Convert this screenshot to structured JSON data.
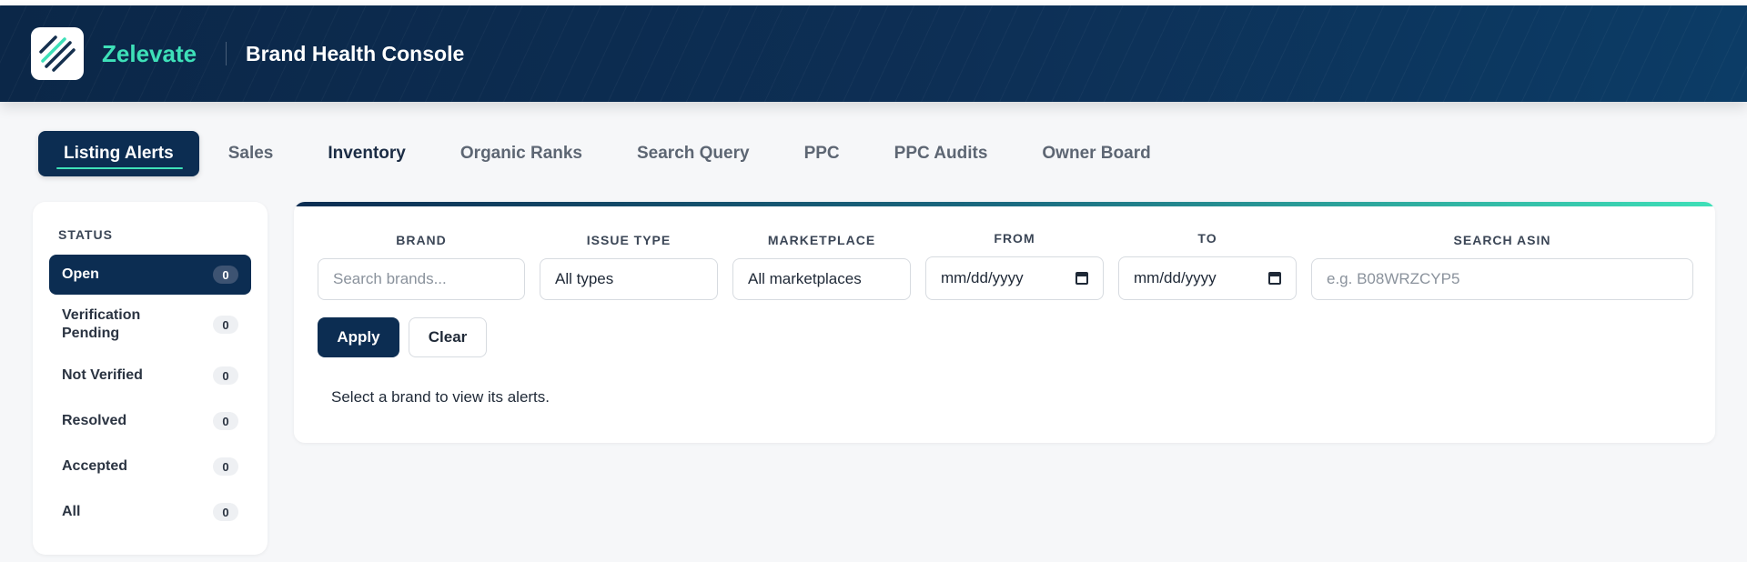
{
  "header": {
    "brand": "Zelevate",
    "title": "Brand Health Console"
  },
  "tabs": [
    {
      "label": "Listing Alerts",
      "active": true
    },
    {
      "label": "Sales"
    },
    {
      "label": "Inventory"
    },
    {
      "label": "Organic Ranks"
    },
    {
      "label": "Search Query"
    },
    {
      "label": "PPC"
    },
    {
      "label": "PPC Audits"
    },
    {
      "label": "Owner Board"
    }
  ],
  "sidebar": {
    "heading": "STATUS",
    "items": [
      {
        "label": "Open",
        "count": "0"
      },
      {
        "label": "Verification Pending",
        "count": "0"
      },
      {
        "label": "Not Verified",
        "count": "0"
      },
      {
        "label": "Resolved",
        "count": "0"
      },
      {
        "label": "Accepted",
        "count": "0"
      },
      {
        "label": "All",
        "count": "0"
      }
    ]
  },
  "filters": {
    "brand_label": "BRAND",
    "brand_placeholder": "Search brands...",
    "issue_label": "ISSUE TYPE",
    "issue_value": "All types",
    "marketplace_label": "MARKETPLACE",
    "marketplace_value": "All marketplaces",
    "from_label": "FROM",
    "from_value": "mm/dd/yyyy",
    "to_label": "TO",
    "to_value": "mm/dd/yyyy",
    "asin_label": "SEARCH ASIN",
    "asin_placeholder": "e.g. B08WRZCYP5",
    "apply_label": "Apply",
    "clear_label": "Clear"
  },
  "message": "Select a brand to view its alerts.",
  "colors": {
    "accent": "#3ee0b8",
    "primary": "#0c2d52"
  }
}
